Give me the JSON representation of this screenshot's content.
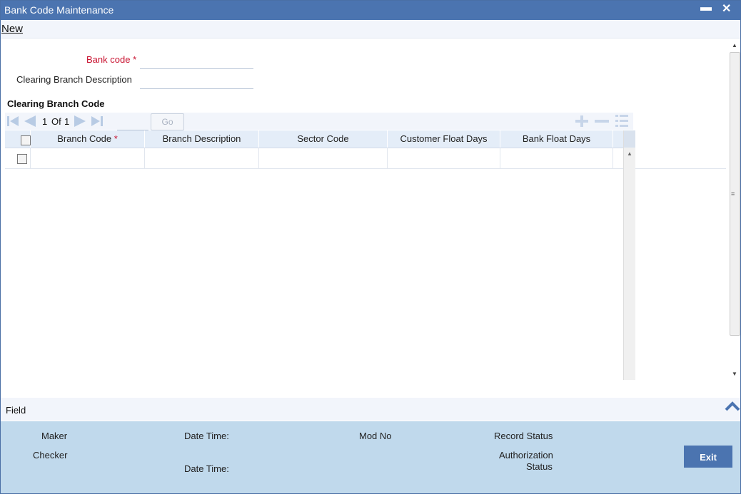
{
  "window": {
    "title": "Bank Code Maintenance",
    "minimize_glyph": "▬",
    "close_glyph": "✕"
  },
  "menu": {
    "new_label": "New"
  },
  "form": {
    "bank_code_label": "Bank code",
    "required_mark": "*",
    "bank_code_value": "",
    "clearing_branch_description_label": "Clearing Branch Description",
    "clearing_branch_description_value": ""
  },
  "section": {
    "title": "Clearing Branch Code"
  },
  "pager": {
    "current": "1",
    "of_label": "Of",
    "total": "1",
    "go_label": "Go",
    "page_input": ""
  },
  "grid": {
    "columns": [
      {
        "label": "Branch Code",
        "required": "*"
      },
      {
        "label": "Branch Description"
      },
      {
        "label": "Sector Code"
      },
      {
        "label": "Customer Float Days"
      },
      {
        "label": "Bank Float Days"
      }
    ]
  },
  "footer": {
    "field_label": "Field"
  },
  "audit": {
    "maker_label": "Maker",
    "checker_label": "Checker",
    "date_time_label_1": "Date Time:",
    "date_time_label_2": "Date Time:",
    "mod_no_label": "Mod No",
    "record_status_label": "Record Status",
    "authorization_label_line1": "Authorization",
    "authorization_label_line2": "Status",
    "exit_label": "Exit"
  },
  "colors": {
    "titlebar": "#4b74b0",
    "required": "#c8102e",
    "audit_panel": "#c0d9ec",
    "grid_header": "#e4edf8"
  }
}
